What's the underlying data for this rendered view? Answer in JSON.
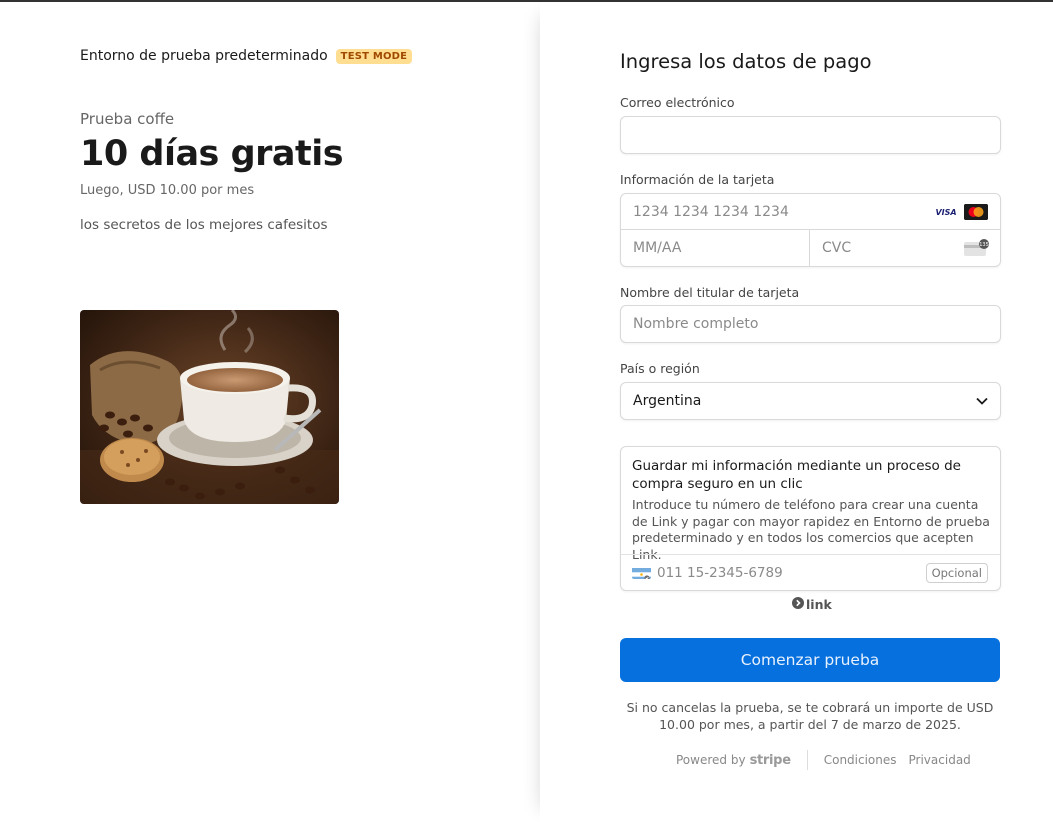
{
  "merchant": {
    "name": "Entorno de prueba predeterminado",
    "badge": "TEST MODE"
  },
  "product": {
    "name": "Prueba coffe",
    "trial": "10 días gratis",
    "then": "Luego, USD 10.00 por mes",
    "description": "los secretos de los mejores cafesitos"
  },
  "payment": {
    "title": "Ingresa los datos de pago",
    "email": {
      "label": "Correo electrónico",
      "value": "",
      "placeholder": ""
    },
    "card": {
      "label": "Información de la tarjeta",
      "number_placeholder": "1234 1234 1234 1234",
      "expiry_placeholder": "MM/AA",
      "cvc_placeholder": "CVC",
      "brands": [
        "visa-icon",
        "mastercard-icon"
      ],
      "visa_text": "VISA",
      "cvc_icon_text": "135"
    },
    "holder": {
      "label": "Nombre del titular de tarjeta",
      "placeholder": "Nombre completo"
    },
    "country": {
      "label": "País o región",
      "value": "Argentina"
    }
  },
  "link": {
    "title": "Guardar mi información mediante un proceso de compra seguro en un clic",
    "text": "Introduce tu número de teléfono para crear una cuenta de Link y pagar con mayor rapidez en Entorno de prueba predeterminado y en todos los comercios que acepten Link.",
    "phone_placeholder": "011 15-2345-6789",
    "optional": "Opcional",
    "brand": "link"
  },
  "submit_label": "Comenzar prueba",
  "notice": "Si no cancelas la prueba, se te cobrará un importe de USD 10.00 por mes, a partir del 7 de marzo de 2025.",
  "footer": {
    "powered_by": "Powered by",
    "stripe": "stripe",
    "terms": "Condiciones",
    "privacy": "Privacidad"
  },
  "colors": {
    "accent": "#0570de",
    "badge_bg": "#ffde92",
    "badge_text": "#a04a00"
  }
}
